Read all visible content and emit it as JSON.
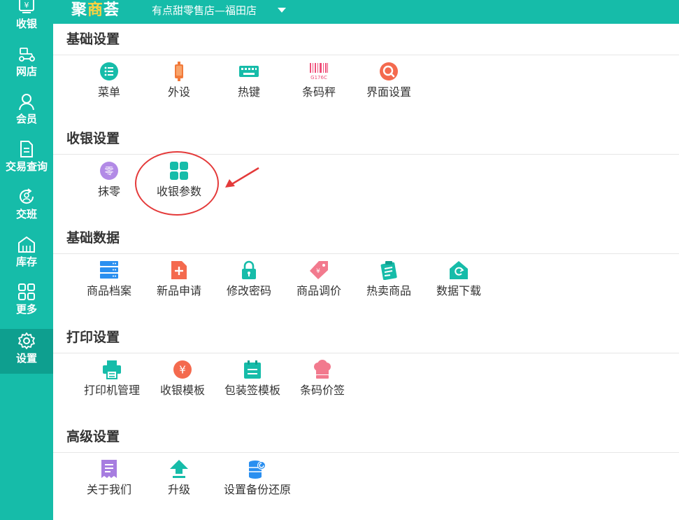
{
  "header": {
    "logo_main": "聚",
    "logo_accent": "商",
    "logo_tail": "荟",
    "store_name": "有点甜零售店—福田店"
  },
  "sidebar": {
    "items": [
      {
        "label": "收银",
        "icon": "cashier-icon"
      },
      {
        "label": "网店",
        "icon": "scooter-icon"
      },
      {
        "label": "会员",
        "icon": "member-icon"
      },
      {
        "label": "交易查询",
        "icon": "document-icon"
      },
      {
        "label": "交班",
        "icon": "shift-icon"
      },
      {
        "label": "库存",
        "icon": "warehouse-icon"
      },
      {
        "label": "更多",
        "icon": "grid-icon"
      },
      {
        "label": "设置",
        "icon": "gear-icon",
        "active": true
      }
    ]
  },
  "sections": {
    "basic_settings": {
      "title": "基础设置",
      "items": [
        {
          "label": "菜单",
          "icon": "menu-list-icon"
        },
        {
          "label": "外设",
          "icon": "device-icon"
        },
        {
          "label": "热键",
          "icon": "keyboard-icon"
        },
        {
          "label": "条码秤",
          "icon": "barcode-icon",
          "icon_text": "G176C"
        },
        {
          "label": "界面设置",
          "icon": "magnify-icon"
        }
      ]
    },
    "cashier_settings": {
      "title": "收银设置",
      "items": [
        {
          "label": "抹零",
          "icon": "zero-icon",
          "icon_text": "零"
        },
        {
          "label": "收银参数",
          "icon": "tiles-icon"
        }
      ]
    },
    "basic_data": {
      "title": "基础数据",
      "items": [
        {
          "label": "商品档案",
          "icon": "server-icon"
        },
        {
          "label": "新品申请",
          "icon": "new-file-icon"
        },
        {
          "label": "修改密码",
          "icon": "lock-icon"
        },
        {
          "label": "商品调价",
          "icon": "price-tag-icon"
        },
        {
          "label": "热卖商品",
          "icon": "clipboard-icon"
        },
        {
          "label": "数据下载",
          "icon": "sync-home-icon"
        }
      ]
    },
    "print_settings": {
      "title": "打印设置",
      "items": [
        {
          "label": "打印机管理",
          "icon": "printer-icon"
        },
        {
          "label": "收银模板",
          "icon": "yen-icon",
          "icon_text": "¥"
        },
        {
          "label": "包装签模板",
          "icon": "calendar-icon"
        },
        {
          "label": "条码价签",
          "icon": "chef-hat-icon"
        }
      ]
    },
    "advanced_settings": {
      "title": "高级设置",
      "items": [
        {
          "label": "关于我们",
          "icon": "receipt-icon"
        },
        {
          "label": "升级",
          "icon": "upload-icon"
        },
        {
          "label": "设置备份还原",
          "icon": "backup-icon"
        }
      ]
    }
  },
  "colors": {
    "primary": "#16bca9",
    "sidebar_active": "#0e9f8f",
    "annotation": "#e43a3a"
  }
}
